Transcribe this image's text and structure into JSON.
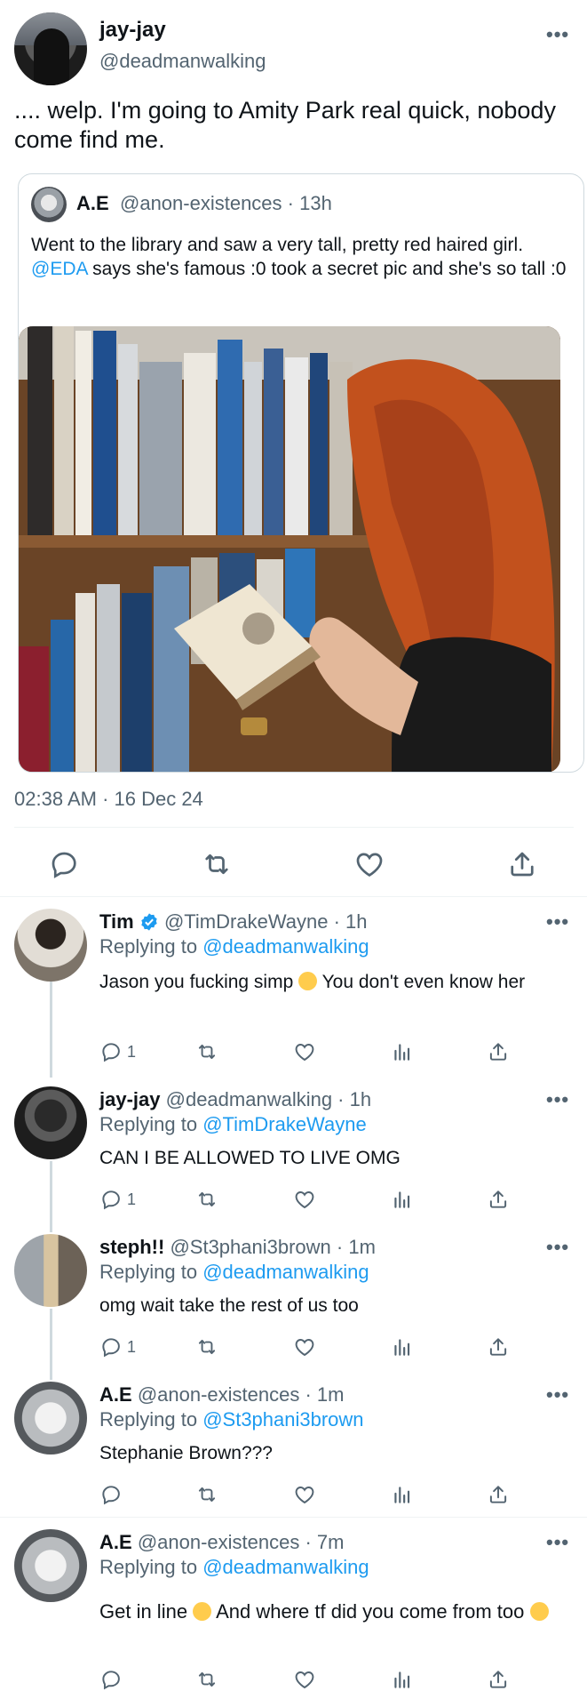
{
  "main_tweet": {
    "display_name": "jay-jay",
    "handle": "@deadmanwalking",
    "text": ".... welp. I'm going to Amity Park real quick, nobody come find me.",
    "more_label": "•••",
    "timestamp": "02:38 AM · 16 Dec 24",
    "quote": {
      "display_name": "A.E",
      "meta": "@anon-existences · 13h",
      "text_before": "Went to the library and saw a very tall, pretty red haired girl. ",
      "mention": "@EDA",
      "text_after": " says she's famous :0 took a secret pic and she's so tall :0",
      "photo_icon": "library-photo"
    },
    "actions": [
      "reply-icon",
      "retweet-icon",
      "like-icon",
      "share-icon"
    ]
  },
  "replies": [
    {
      "display_name": "Tim",
      "verified": true,
      "meta": "@TimDrakeWayne · 1h",
      "replying_label": "Replying to",
      "replying_to": "@deadmanwalking",
      "text": "Jason you fucking simp",
      "emoji": "loudly-crying-face",
      "text_after": " You don't even know her",
      "reply_count": "1"
    },
    {
      "display_name": "jay-jay",
      "meta": "@deadmanwalking · 1h",
      "replying_label": "Replying to",
      "replying_to": "@TimDrakeWayne",
      "text": "CAN I BE ALLOWED TO LIVE OMG",
      "reply_count": "1"
    },
    {
      "display_name": "steph!!",
      "meta": "@St3phani3brown · 1m",
      "replying_label": "Replying to",
      "replying_to": "@deadmanwalking",
      "text": "omg wait take the rest of us too",
      "reply_count": "1"
    },
    {
      "display_name": "A.E",
      "meta": "@anon-existences · 1m",
      "replying_label": "Replying to",
      "replying_to": "@St3phani3brown",
      "text": "Stephanie Brown???",
      "reply_count": ""
    },
    {
      "display_name": "A.E",
      "meta": "@anon-existences · 7m",
      "replying_label": "Replying to",
      "replying_to": "@deadmanwalking",
      "text": "Get in line",
      "emoji": "unamused-face",
      "text_after": " And where tf did you come from too",
      "emoji2": "loudly-crying-face",
      "reply_count": ""
    }
  ],
  "colors": {
    "link": "#1d9bf0",
    "secondary_text": "#536471",
    "divider": "#eff3f4"
  }
}
